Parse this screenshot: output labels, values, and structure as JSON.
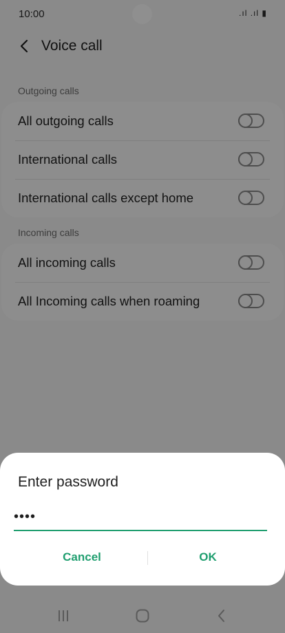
{
  "status_bar": {
    "time": "10:00",
    "icons": ".ıl .ıl ▮"
  },
  "header": {
    "title": "Voice call"
  },
  "sections": {
    "outgoing": {
      "label": "Outgoing calls",
      "items": [
        {
          "label": "All outgoing calls",
          "enabled": false
        },
        {
          "label": "International calls",
          "enabled": false
        },
        {
          "label": "International calls except home",
          "enabled": false
        }
      ]
    },
    "incoming": {
      "label": "Incoming calls",
      "items": [
        {
          "label": "All incoming calls",
          "enabled": false
        },
        {
          "label": "All Incoming calls when roaming",
          "enabled": false
        }
      ]
    }
  },
  "dialog": {
    "title": "Enter password",
    "password_value": "••••",
    "cancel_label": "Cancel",
    "ok_label": "OK"
  },
  "nav_bar": {
    "recent": "recents-icon",
    "home": "home-icon",
    "back": "back-icon"
  },
  "colors": {
    "accent": "#1f9e6f",
    "scrim": "rgba(0,0,0,0.44)"
  }
}
